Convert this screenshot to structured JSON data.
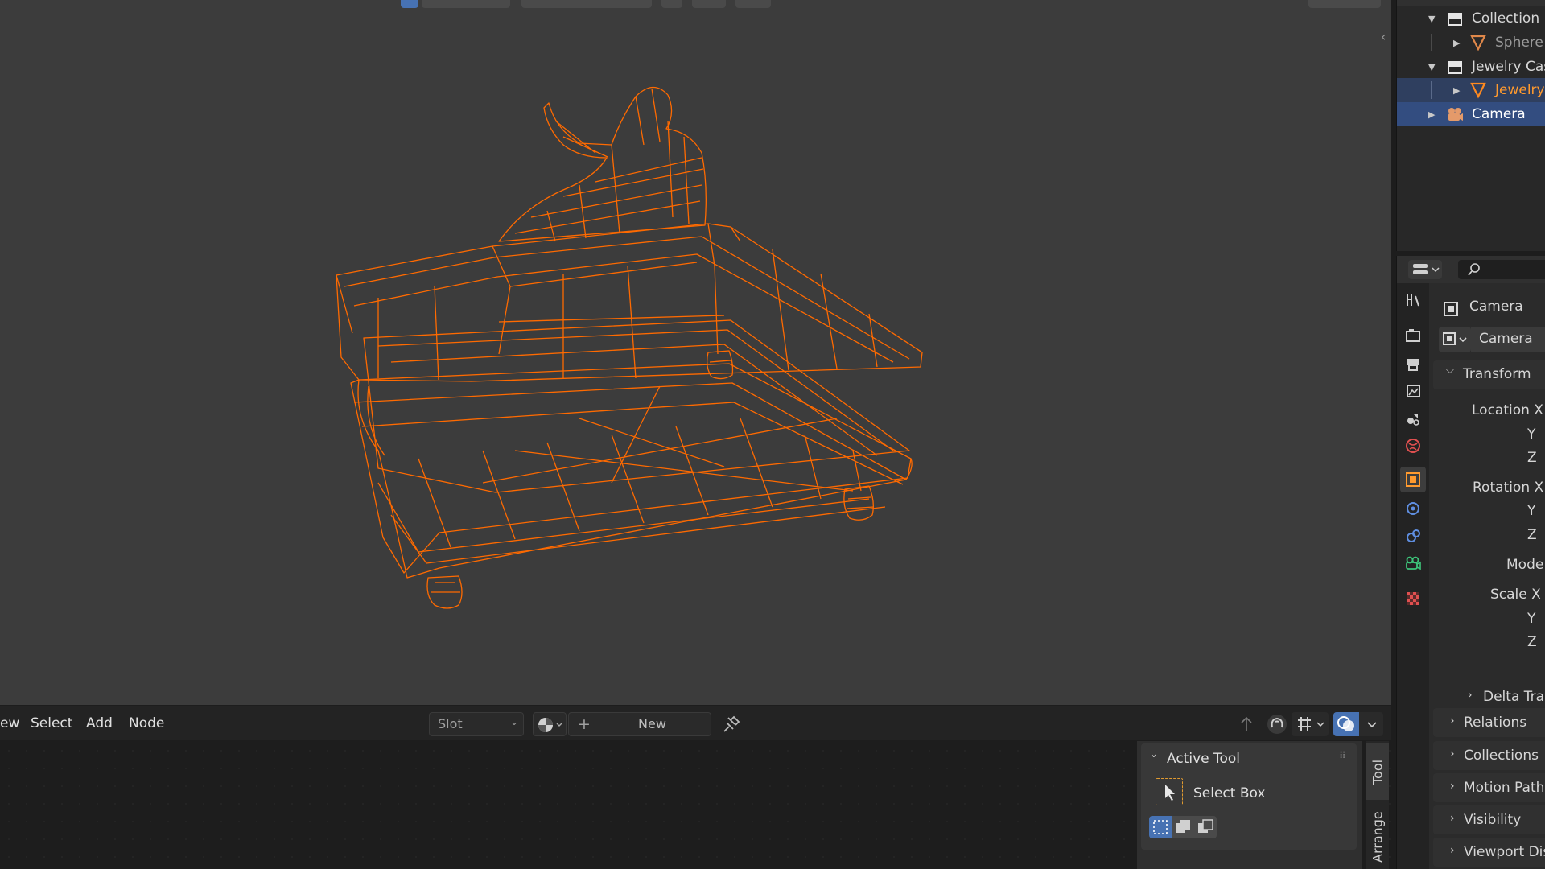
{
  "outliner": {
    "items": [
      {
        "label": "Collection",
        "icon": "collection-icon",
        "expanded": true
      },
      {
        "label": "Sphere",
        "icon": "mesh-icon",
        "expanded": false
      },
      {
        "label": "Jewelry Case",
        "icon": "collection-icon",
        "expanded": true
      },
      {
        "label": "Jewelry",
        "icon": "mesh-icon",
        "expanded": false
      },
      {
        "label": "Camera",
        "icon": "camera-icon",
        "expanded": false
      }
    ]
  },
  "properties": {
    "object_name": "Camera",
    "data_name": "Camera",
    "transform_label": "Transform",
    "location_x": "Location X",
    "location_y": "Y",
    "location_z": "Z",
    "rotation_x": "Rotation X",
    "rotation_y": "Y",
    "rotation_z": "Z",
    "mode": "Mode",
    "scale_x": "Scale X",
    "scale_y": "Y",
    "scale_z": "Z",
    "delta_transform": "Delta Tran",
    "relations": "Relations",
    "collections": "Collections",
    "motion_paths": "Motion Paths",
    "visibility": "Visibility",
    "viewport_display": "Viewport Disp"
  },
  "node_editor": {
    "menu": {
      "view": "ew",
      "select": "Select",
      "add": "Add",
      "node": "Node"
    },
    "slot": "Slot",
    "new_label": "New"
  },
  "tool_panel": {
    "header": "Active Tool",
    "tool_name": "Select Box",
    "tab_tool": "Tool",
    "tab_arrange": "Arrange"
  },
  "colors": {
    "selection_orange": "#ff6a00",
    "active_blue": "#4772b3",
    "viewport_bg": "#3c3c3c"
  }
}
